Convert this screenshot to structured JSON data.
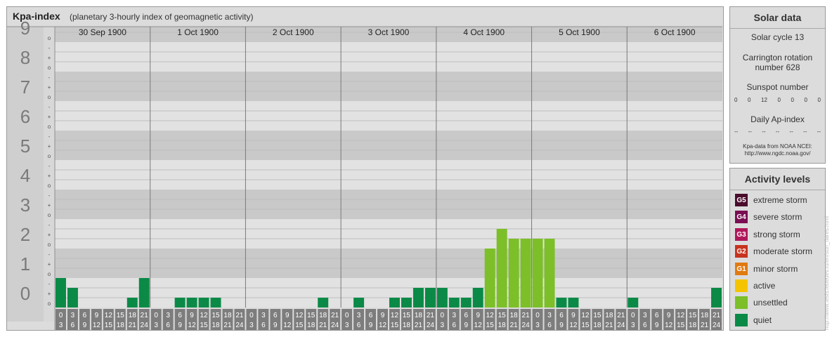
{
  "chart": {
    "title": "Kpa-index",
    "subtitle": "(planetary 3-hourly index of geomagnetic activity)"
  },
  "chart_data": {
    "type": "bar",
    "title": "Kpa-index",
    "subtitle": "(planetary 3-hourly index of geomagnetic activity)",
    "ylim": [
      0,
      9
    ],
    "y_ticks": [
      "0",
      "1",
      "2",
      "3",
      "4",
      "5",
      "6",
      "7",
      "8",
      "9"
    ],
    "y_minor_ticks": [
      "o",
      "+",
      "-"
    ],
    "days": [
      "30 Sep 1900",
      "1 Oct 1900",
      "2 Oct 1900",
      "3 Oct 1900",
      "4 Oct 1900",
      "5 Oct 1900",
      "6 Oct 1900"
    ],
    "interval_start": [
      "0",
      "3",
      "6",
      "9",
      "12",
      "15",
      "18",
      "21"
    ],
    "interval_end": [
      "3",
      "6",
      "9",
      "12",
      "15",
      "18",
      "21",
      "24"
    ],
    "values": [
      [
        1,
        0.667,
        0,
        0,
        0,
        0,
        0.333,
        1
      ],
      [
        0,
        0,
        0.333,
        0.333,
        0.333,
        0.333,
        0,
        0
      ],
      [
        0,
        0,
        0,
        0,
        0,
        0,
        0.333,
        0
      ],
      [
        0,
        0.333,
        0,
        0,
        0.333,
        0.333,
        0.667,
        0.667
      ],
      [
        0.667,
        0.333,
        0.333,
        0.667,
        2,
        2.667,
        2.333,
        2.333
      ],
      [
        2.333,
        2.333,
        0.333,
        0.333,
        0,
        0,
        0,
        0
      ],
      [
        0.333,
        0,
        0,
        0,
        0,
        0,
        0,
        0.667
      ]
    ],
    "colors": {
      "quiet": "#0a8a46",
      "unsettled": "#7cbf28",
      "active": "#f5c400",
      "minor_storm": "#e07a10",
      "moderate_storm": "#c8331e",
      "strong_storm": "#b0185a",
      "severe_storm": "#7a0e52",
      "extreme_storm": "#4a0b2c"
    }
  },
  "sidebar": {
    "solar": {
      "title": "Solar data",
      "cycle": "Solar cycle 13",
      "carrington_1": "Carrington rotation",
      "carrington_2": "number 628",
      "sunspot_label": "Sunspot number",
      "sunspot_values": [
        "0",
        "0",
        "12",
        "0",
        "0",
        "0",
        "0"
      ],
      "ap_label": "Daily Ap-index",
      "ap_values": [
        "--",
        "--",
        "--",
        "--",
        "--",
        "--",
        "--"
      ],
      "source_1": "Kpa-data from NOAA NCEI:",
      "source_2": "http://www.ngdc.noaa.gov/"
    },
    "activity": {
      "title": "Activity levels",
      "levels": [
        {
          "badge": "G5",
          "label": "extreme storm",
          "color": "#4a0b2c"
        },
        {
          "badge": "G4",
          "label": "severe storm",
          "color": "#7a0e52"
        },
        {
          "badge": "G3",
          "label": "strong storm",
          "color": "#b0185a"
        },
        {
          "badge": "G2",
          "label": "moderate storm",
          "color": "#c8331e"
        },
        {
          "badge": "G1",
          "label": "minor storm",
          "color": "#e07a10"
        },
        {
          "badge": "",
          "label": "active",
          "color": "#f5c400"
        },
        {
          "badge": "",
          "label": "unsettled",
          "color": "#7cbf28"
        },
        {
          "badge": "",
          "label": "quiet",
          "color": "#0a8a46"
        }
      ]
    }
  },
  "credit": "http://www.tesis.lebedev.ru/en/sun_flares.html"
}
